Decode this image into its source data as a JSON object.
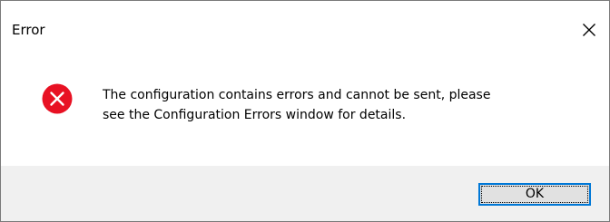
{
  "window": {
    "title": "Error",
    "close_icon": "close-icon"
  },
  "message": {
    "icon": "error-icon",
    "icon_color": "#e81123",
    "text": "The configuration contains errors and cannot be sent, please\nsee the Configuration Errors window for details."
  },
  "buttons": {
    "ok_label": "OK",
    "accent": "#0078d7"
  }
}
